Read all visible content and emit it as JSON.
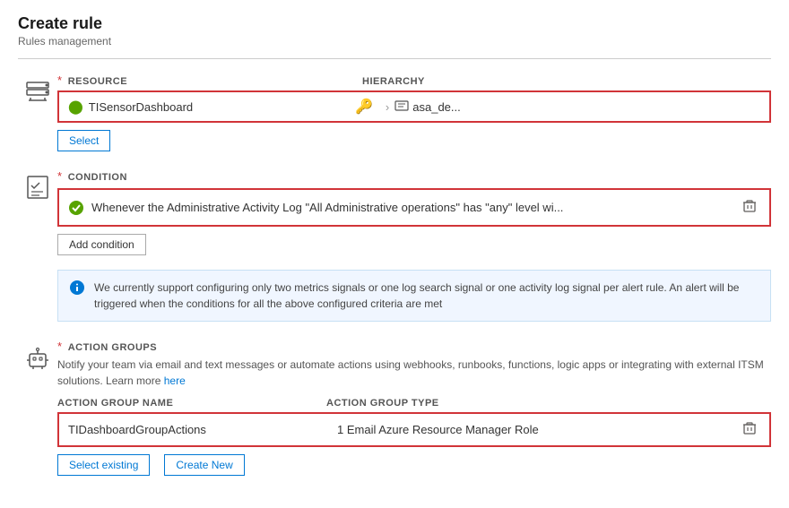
{
  "page": {
    "title": "Create rule",
    "subtitle": "Rules management"
  },
  "resource_section": {
    "label": "RESOURCE",
    "hierarchy_label": "HIERARCHY",
    "resource_name": "TISensorDashboard",
    "hierarchy_chevron": ">",
    "hierarchy_value": "asa_de...",
    "select_button": "Select"
  },
  "condition_section": {
    "label": "CONDITION",
    "condition_text": "Whenever the Administrative Activity Log \"All Administrative operations\" has \"any\" level wi...",
    "add_condition_button": "Add condition",
    "info_text": "We currently support configuring only two metrics signals or one log search signal or one activity log signal per alert rule. An alert will be triggered when the conditions for all the above configured criteria are met"
  },
  "action_groups_section": {
    "label": "ACTION GROUPS",
    "description": "Notify your team via email and text messages or automate actions using webhooks, runbooks, functions, logic apps or integrating with external ITSM solutions. Learn more",
    "learn_more_link": "here",
    "col_name": "ACTION GROUP NAME",
    "col_type": "ACTION GROUP TYPE",
    "group_name": "TIDashboardGroupActions",
    "group_type": "1 Email Azure Resource Manager Role",
    "select_existing_button": "Select existing",
    "create_new_button": "Create New"
  },
  "icons": {
    "resource_green_icon": "⚡",
    "key_icon": "🔑",
    "check_circle": "✅",
    "info_circle": "ℹ",
    "trash": "🗑"
  }
}
